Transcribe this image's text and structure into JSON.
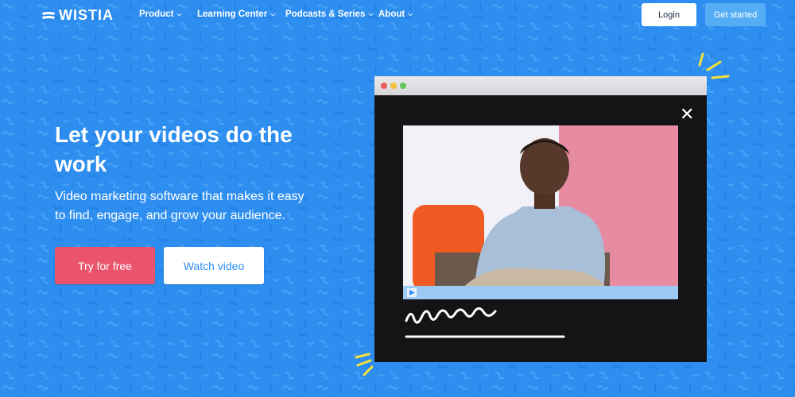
{
  "brand": {
    "name": "WISTIA"
  },
  "nav": {
    "items": [
      {
        "label": "Product"
      },
      {
        "label": "Learning Center"
      },
      {
        "label": "Podcasts & Series"
      },
      {
        "label": "About"
      }
    ],
    "login_label": "Login",
    "get_started_label": "Get started"
  },
  "hero": {
    "headline": "Let your videos do the work",
    "subheadline": "Video marketing software that makes it easy to find, engage, and grow your audience.",
    "try_label": "Try for free",
    "watch_label": "Watch video"
  },
  "video_window": {
    "close_symbol": "✕"
  },
  "icons": {
    "logo": "wistia-logo-icon",
    "chevron": "chevron-down-icon",
    "close": "close-icon",
    "play": "play-icon"
  },
  "colors": {
    "background": "#2d8ef0",
    "accent_pink": "#e9546c",
    "get_started": "#55aef5",
    "squiggle_yellow": "#f7e03c"
  }
}
